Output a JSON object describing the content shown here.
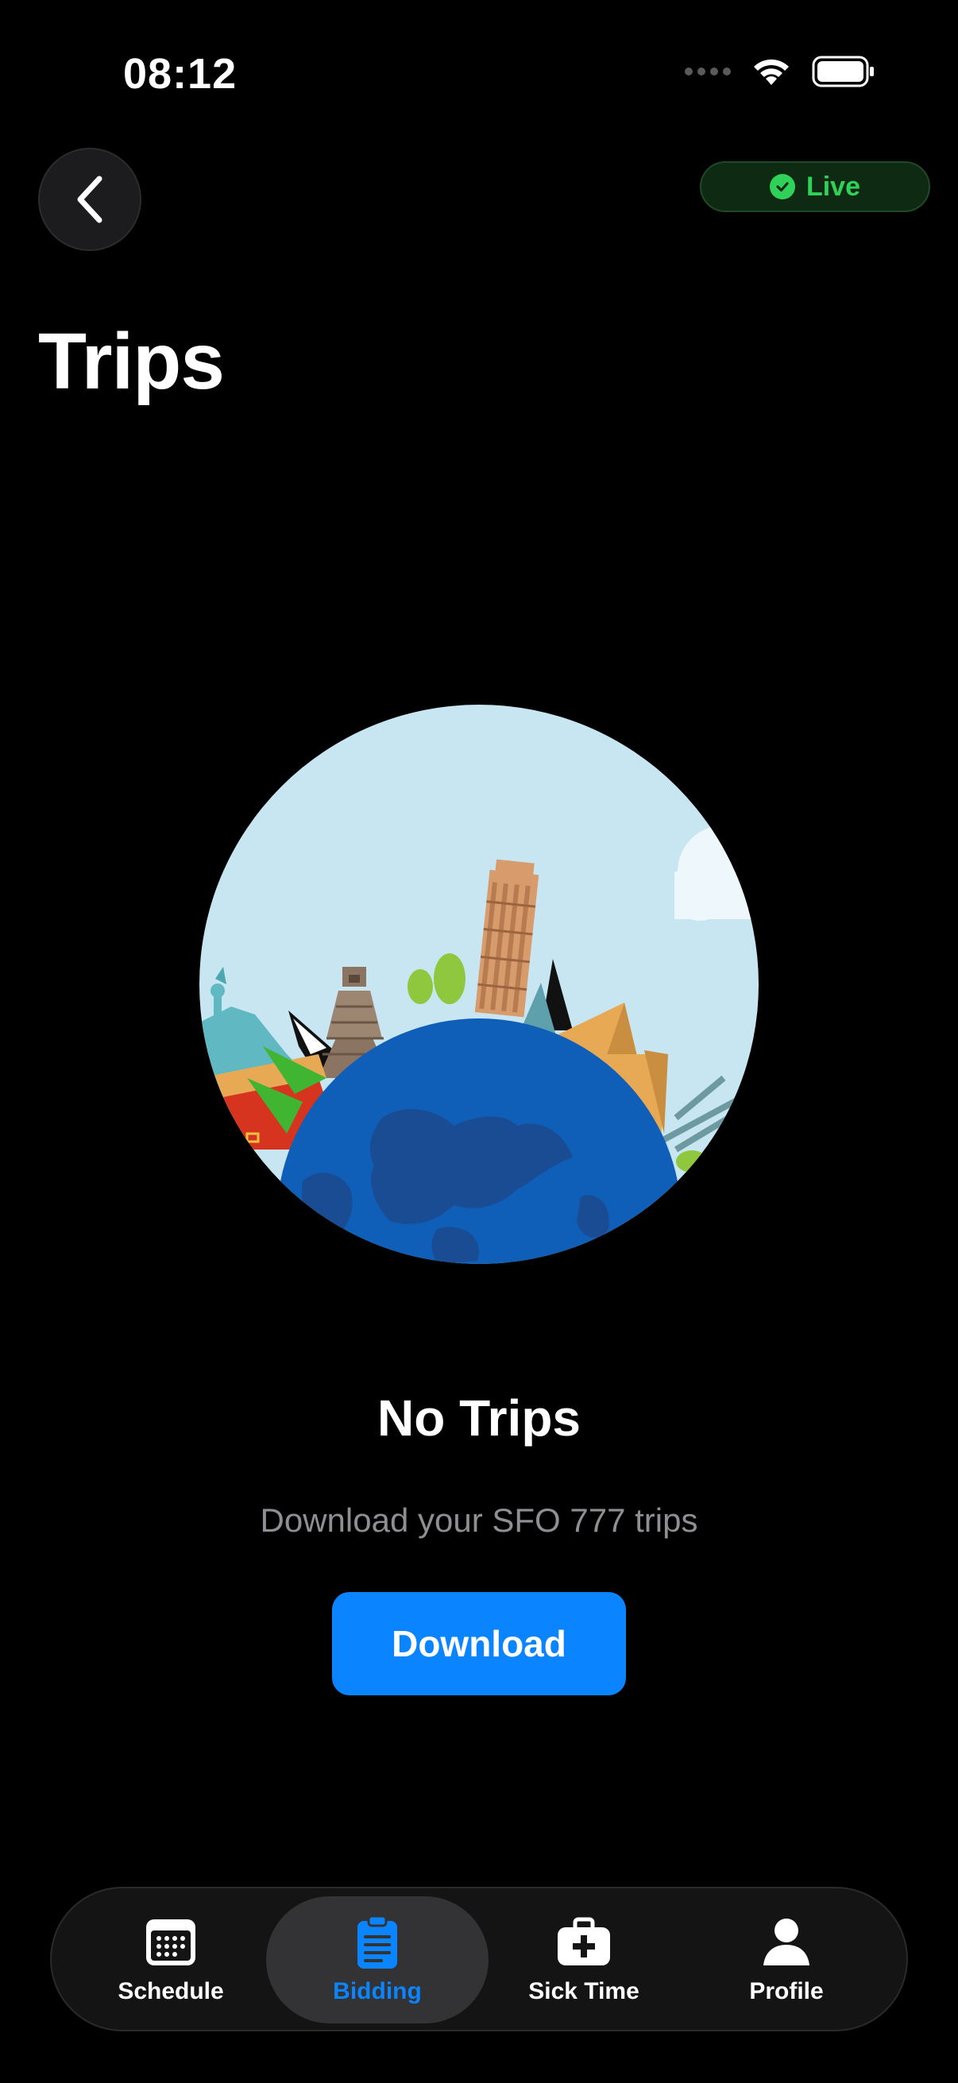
{
  "status_bar": {
    "time": "08:12"
  },
  "header": {
    "back_icon": "chevron-left-icon",
    "live_badge": {
      "label": "Live",
      "icon": "checkmark-circle-icon",
      "color": "#30d158"
    },
    "title": "Trips"
  },
  "empty_state": {
    "title": "No Trips",
    "subtitle": "Download your SFO 777 trips",
    "button_label": "Download",
    "button_color": "#0a84ff"
  },
  "tab_bar": {
    "active_color": "#0a84ff",
    "tabs": [
      {
        "label": "Schedule",
        "icon": "calendar-icon",
        "active": false
      },
      {
        "label": "Bidding",
        "icon": "clipboard-icon",
        "active": true
      },
      {
        "label": "Sick Time",
        "icon": "medical-kit-icon",
        "active": false
      },
      {
        "label": "Profile",
        "icon": "person-icon",
        "active": false
      }
    ]
  }
}
